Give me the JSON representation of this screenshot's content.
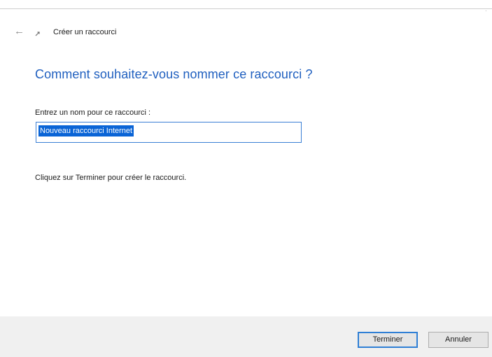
{
  "header": {
    "back_icon": "back-arrow-icon",
    "wizard_icon": "shortcut-wizard-icon",
    "title": "Créer un raccourci"
  },
  "main": {
    "heading": "Comment souhaitez-vous nommer ce raccourci ?",
    "field_label": "Entrez un nom pour ce raccourci :",
    "name_value": "Nouveau raccourci Internet",
    "info_text": "Cliquez sur Terminer pour créer le raccourci."
  },
  "footer": {
    "finish_label": "Terminer",
    "cancel_label": "Annuler"
  },
  "colors": {
    "heading": "#1f5fbf",
    "selection": "#0a64d6",
    "footer_bg": "#f0f0f0",
    "focus_border": "#2f7fd5"
  }
}
